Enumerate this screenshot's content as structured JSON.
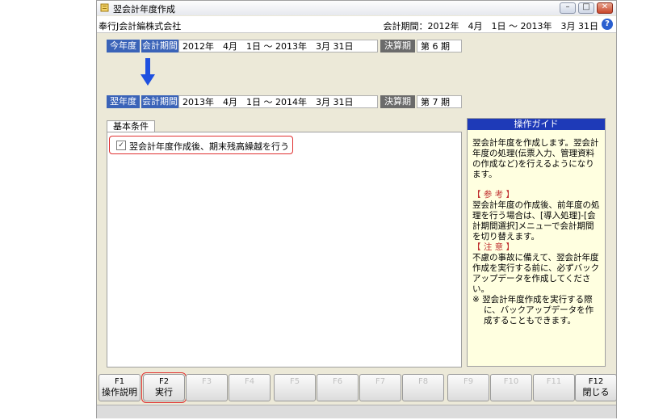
{
  "window": {
    "title": "翌会計年度作成",
    "controls": [
      "–",
      "□",
      "✕"
    ]
  },
  "info": {
    "company": "奉行J会計編株式会社",
    "period_label": "会計期間：",
    "period_value": "2012年　4月　1日 ～ 2013年　3月 31日"
  },
  "current_year": {
    "label": "今年度",
    "period_label": "会計期間",
    "period_value": "2012年　4月　1日 ～ 2013年　3月 31日",
    "term_label": "決算期",
    "term_value": "第 6 期"
  },
  "next_year": {
    "label": "翌年度",
    "period_label": "会計期間",
    "period_value": "2013年　4月　1日 ～ 2014年　3月 31日",
    "term_label": "決算期",
    "term_value": "第 7 期"
  },
  "tab": {
    "label": "基本条件"
  },
  "option": {
    "checked": true,
    "label": "翌会計年度作成後、期末残高繰越を行う"
  },
  "guide": {
    "title": "操作ガイド",
    "intro": "翌会計年度を作成します。翌会計年度の処理(伝票入力、管理資料の作成など)を行えるようになります。",
    "ref_title": "【 参 考 】",
    "ref_body": "翌会計年度の作成後、前年度の処理を行う場合は、[導入処理]-[会計期間選択]メニューで会計期間を切り替えます。",
    "warn_title": "【 注 意 】",
    "warn_body": "不慮の事故に備えて、翌会計年度作成を実行する前に、必ずバックアップデータを作成してください。",
    "note": "※ 翌会計年度作成を実行する際に、バックアップデータを作成することもできます。"
  },
  "fkeys": [
    {
      "key": "F1",
      "label": "操作説明"
    },
    {
      "key": "F2",
      "label": "実行"
    },
    {
      "key": "F3",
      "label": ""
    },
    {
      "key": "F4",
      "label": ""
    },
    {
      "key": "F5",
      "label": ""
    },
    {
      "key": "F6",
      "label": ""
    },
    {
      "key": "F7",
      "label": ""
    },
    {
      "key": "F8",
      "label": ""
    },
    {
      "key": "F9",
      "label": ""
    },
    {
      "key": "F10",
      "label": ""
    },
    {
      "key": "F11",
      "label": ""
    },
    {
      "key": "F12",
      "label": "閉じる"
    }
  ],
  "colors": {
    "label_blue": "#3a63b8",
    "label_gray": "#6b6b6b",
    "guide_header": "#1e3ab8",
    "highlight": "#e03030"
  }
}
